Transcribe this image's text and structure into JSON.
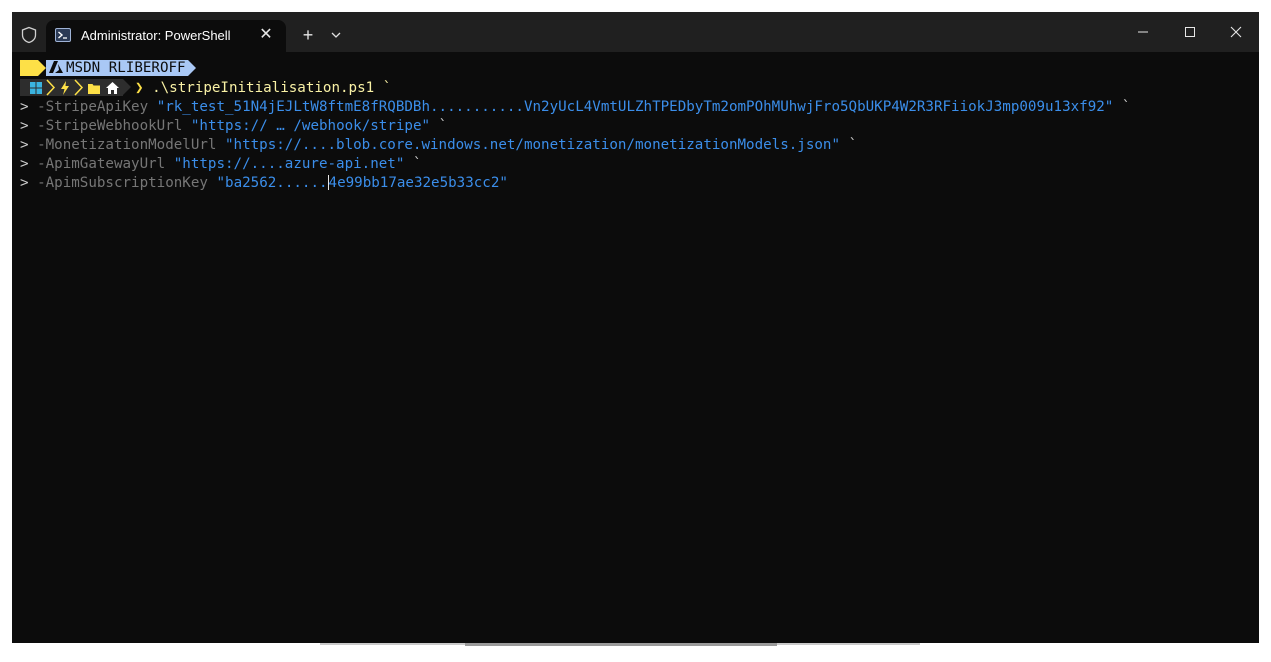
{
  "window": {
    "tab_title": "Administrator: PowerShell",
    "new_tab_symbol": "+",
    "tab_close_symbol": "✕",
    "icons": [
      "shield-icon",
      "powershell-icon",
      "chevron-down-icon",
      "minimize-icon",
      "maximize-icon",
      "close-icon"
    ]
  },
  "prompt": {
    "user": "MSDN RLIBEROFF",
    "path_glyphs": [
      "windows-icon",
      "bolt-icon",
      "folder-icon",
      "home-icon"
    ],
    "chevron": "❯"
  },
  "command": {
    "script": ".\\stripeInitialisation.ps1 `",
    "lines": [
      {
        "prefix": ">",
        "param": "-StripeApiKey",
        "value": "\"rk_test_51N4jEJLtW8ftmE8fRQBDBh...........Vn2yUcL4VmtULZhTPEDbyTm2omPOhMUhwjFro5QbUKP4W2R3RFiiokJ3mp009u13xf92\"",
        "suffix": "`"
      },
      {
        "prefix": ">",
        "param": "-StripeWebhookUrl",
        "value": "\"https:// … /webhook/stripe\"",
        "suffix": "`"
      },
      {
        "prefix": ">",
        "param": "-MonetizationModelUrl",
        "value": "\"https://....blob.core.windows.net/monetization/monetizationModels.json\"",
        "suffix": "`"
      },
      {
        "prefix": ">",
        "param": "-ApimGatewayUrl",
        "value": "\"https://....azure-api.net\"",
        "suffix": "`"
      },
      {
        "prefix": ">",
        "param": "-ApimSubscriptionKey",
        "value_before_cursor": "\"ba2562......",
        "value_after_cursor": "4e99bb17ae32e5b33cc2\"",
        "suffix": ""
      }
    ]
  },
  "colors": {
    "terminal_bg": "#0c0c0c",
    "titlebar_bg": "#202020",
    "string": "#3b8eea",
    "command": "#f9f1a5",
    "param": "#767676",
    "prompt_yellow": "#fde047",
    "prompt_blue": "#a9c8f5"
  }
}
